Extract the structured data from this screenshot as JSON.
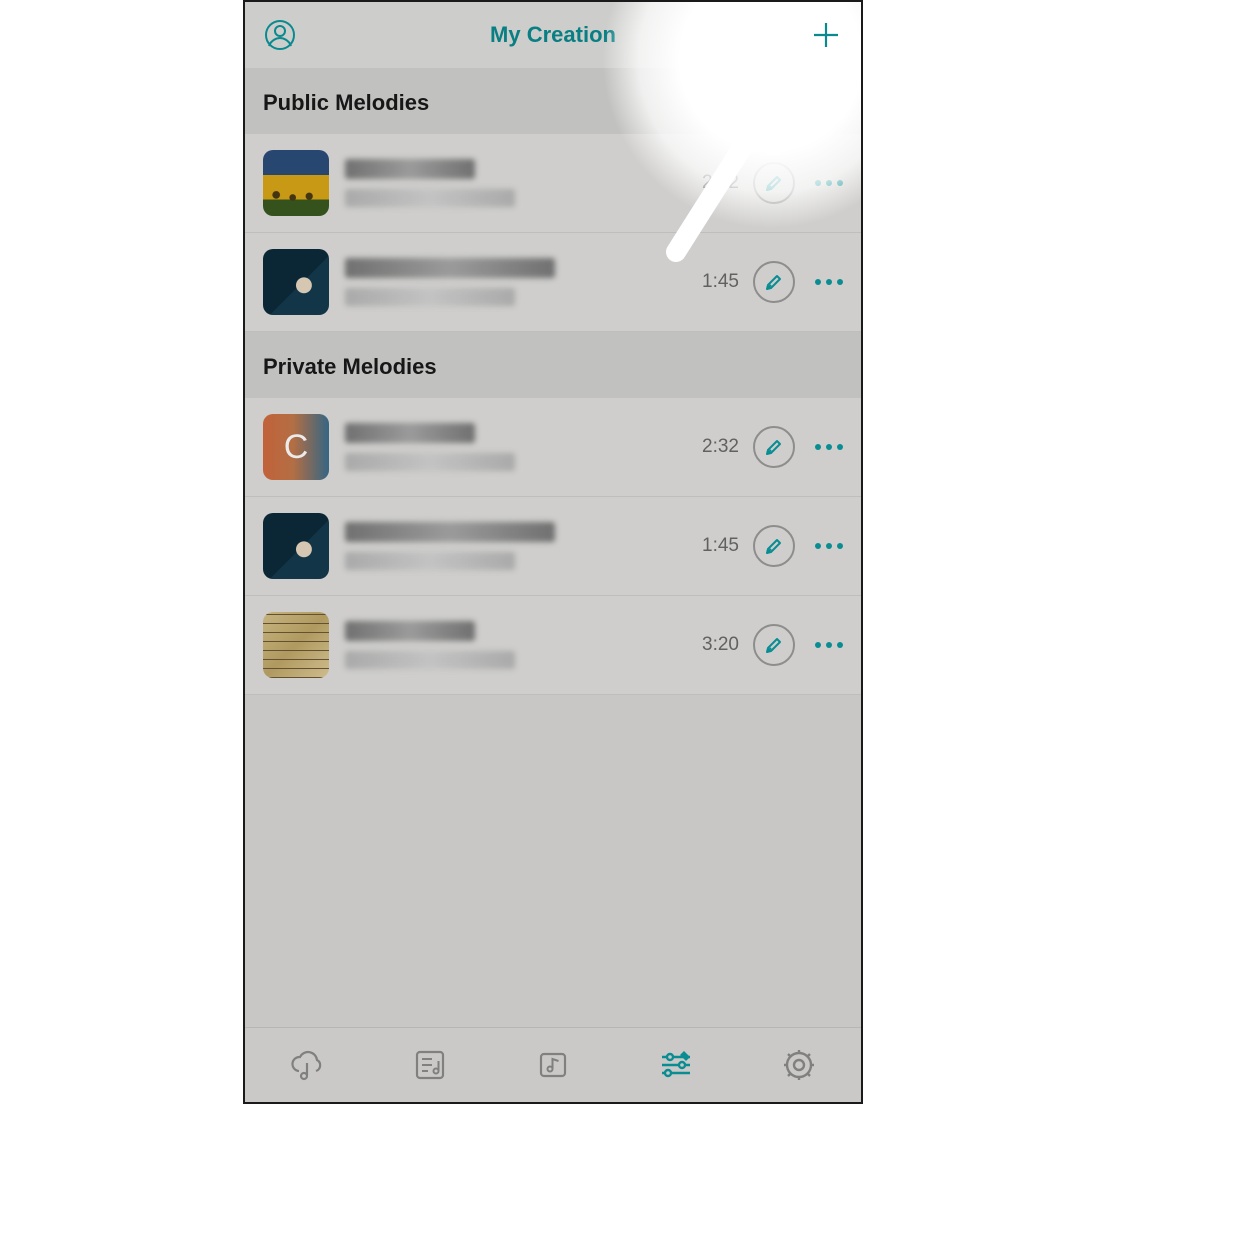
{
  "header": {
    "title": "My Creation"
  },
  "sections": {
    "public": {
      "label": "Public Melodies",
      "items": [
        {
          "duration": "2:32",
          "thumb": "sunflower"
        },
        {
          "duration": "1:45",
          "thumb": "guitar"
        }
      ]
    },
    "private": {
      "label": "Private Melodies",
      "items": [
        {
          "duration": "2:32",
          "thumb": "gradient",
          "letter": "C"
        },
        {
          "duration": "1:45",
          "thumb": "guitar"
        },
        {
          "duration": "3:20",
          "thumb": "sheet"
        }
      ]
    }
  },
  "colors": {
    "accent": "#0a9aa0",
    "muted": "#8b8b89"
  },
  "tabs": {
    "activeIndex": 3
  }
}
